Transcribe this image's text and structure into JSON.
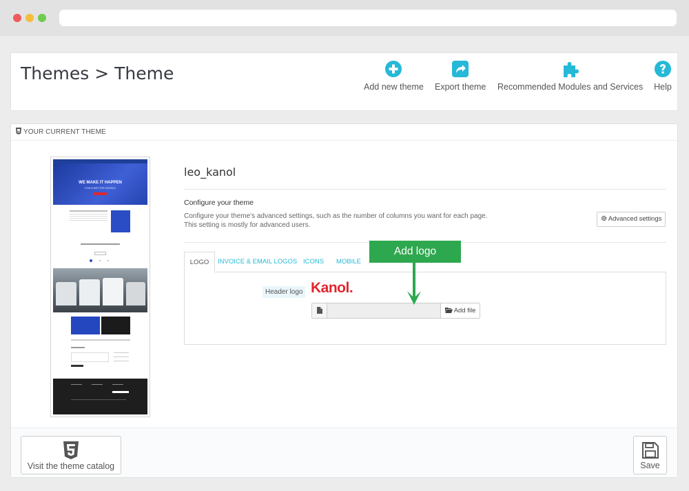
{
  "header": {
    "title": "Themes > Theme",
    "toolbar": [
      {
        "label": "Add new theme",
        "icon": "plus-circle-icon"
      },
      {
        "label": "Export theme",
        "icon": "share-icon"
      },
      {
        "label": "Recommended Modules and Services",
        "icon": "puzzle-icon"
      },
      {
        "label": "Help",
        "icon": "question-circle-icon"
      }
    ]
  },
  "panel": {
    "heading": "YOUR CURRENT THEME",
    "theme_name": "leo_kanol",
    "configure_title": "Configure your theme",
    "configure_description": "Configure your theme's advanced settings, such as the number of columns you want for each page. This setting is mostly for advanced users.",
    "advanced_button": "Advanced settings",
    "tabs": [
      {
        "label": "LOGO",
        "active": true
      },
      {
        "label": "INVOICE & EMAIL LOGOS",
        "active": false
      },
      {
        "label": "ICONS",
        "active": false
      },
      {
        "label": "MOBILE",
        "active": false
      }
    ],
    "logo_section": {
      "label": "Header logo",
      "logo_text": "Kanol.",
      "file_input_value": "",
      "add_file_label": "Add file"
    },
    "preview_text": {
      "hero": "WE MAKE IT HAPPEN",
      "hero_sub": "FOR A BETTER WORLD"
    }
  },
  "annotation": {
    "text": "Add logo"
  },
  "footer": {
    "catalog_button": "Visit the theme catalog",
    "save_button": "Save"
  },
  "colors": {
    "accent": "#25b9d7",
    "annotation": "#2ea84f",
    "logo_red": "#e1262d"
  }
}
